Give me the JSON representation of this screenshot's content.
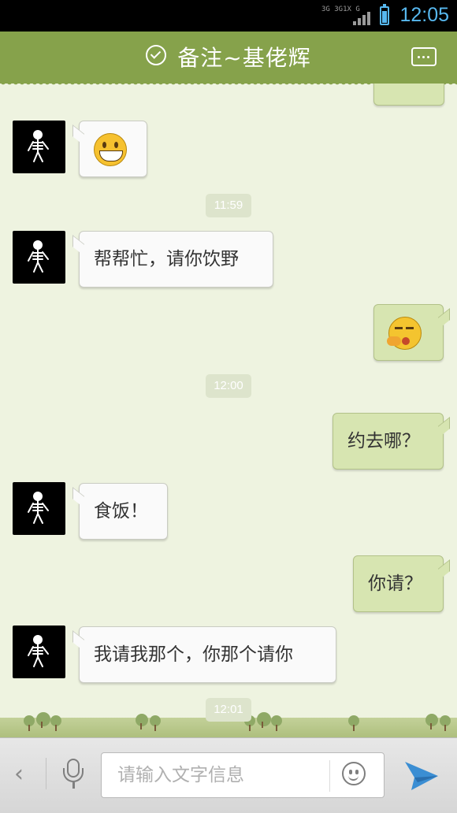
{
  "status_bar": {
    "network_1": "3G 3G1X G",
    "time": "12:05"
  },
  "header": {
    "title": "备注~基佬辉"
  },
  "messages": [
    {
      "side": "left",
      "type": "emoji",
      "emoji": "grinning-emoji"
    },
    {
      "side": "time",
      "text": "11:59"
    },
    {
      "side": "left",
      "type": "text",
      "text": "帮帮忙，请你饮野"
    },
    {
      "side": "right",
      "type": "emoji",
      "emoji": "thinking-emoji"
    },
    {
      "side": "time",
      "text": "12:00"
    },
    {
      "side": "right",
      "type": "text",
      "text": "约去哪？"
    },
    {
      "side": "left",
      "type": "text",
      "text": "食饭！"
    },
    {
      "side": "right",
      "type": "text",
      "text": "你请？"
    },
    {
      "side": "left",
      "type": "text",
      "text": "我请我那个，你那个请你"
    },
    {
      "side": "time",
      "text": "12:01"
    }
  ],
  "input_bar": {
    "placeholder": "请输入文字信息"
  },
  "colors": {
    "header": "#86a24b",
    "chat_background": "#eef3e0",
    "bubble_incoming": "#fafafa",
    "bubble_outgoing": "#d7e5b1",
    "status_time": "#57b8ef"
  }
}
